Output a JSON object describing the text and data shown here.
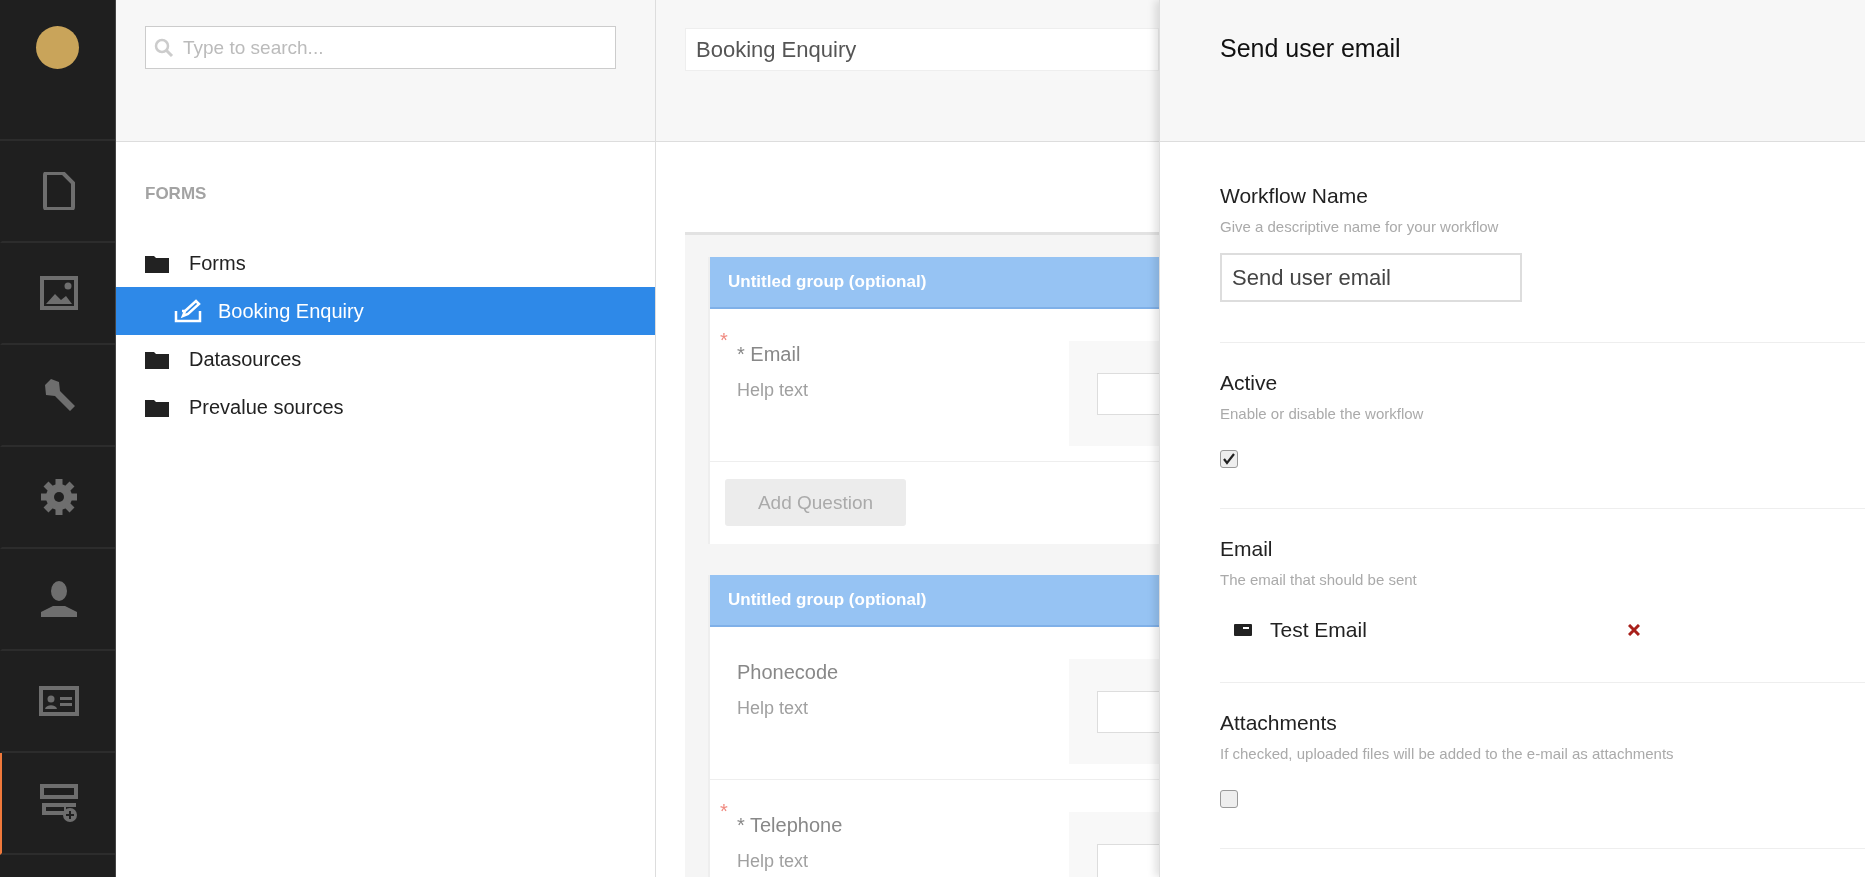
{
  "nav": {
    "sections": [
      {
        "kind": "document",
        "selected": false
      },
      {
        "kind": "image",
        "selected": false
      },
      {
        "kind": "wrench",
        "selected": false
      },
      {
        "kind": "gear",
        "selected": false
      },
      {
        "kind": "user",
        "selected": false
      },
      {
        "kind": "card",
        "selected": false
      },
      {
        "kind": "forms",
        "selected": true
      }
    ]
  },
  "tree": {
    "search": {
      "placeholder": "Type to search..."
    },
    "heading": "FORMS",
    "items": [
      {
        "label": "Forms",
        "kind": "folder",
        "selected": false,
        "children": [
          {
            "label": "Booking Enquiry",
            "kind": "form",
            "selected": true
          }
        ]
      },
      {
        "label": "Datasources",
        "kind": "folder",
        "selected": false
      },
      {
        "label": "Prevalue sources",
        "kind": "folder",
        "selected": false
      }
    ]
  },
  "editor": {
    "name": "Booking Enquiry",
    "groups": [
      {
        "title": "Untitled group (optional)",
        "questions": [
          {
            "required_mark": "*",
            "label": "* Email",
            "help": "Help text"
          }
        ],
        "add_button": "Add Question"
      },
      {
        "title": "Untitled group (optional)",
        "questions": [
          {
            "label": "Phonecode",
            "help": "Help text"
          },
          {
            "required_mark": "*",
            "label": "* Telephone",
            "help": "Help text"
          }
        ]
      }
    ]
  },
  "panel": {
    "title": "Send user email",
    "fields": [
      {
        "kind": "text",
        "label": "Workflow Name",
        "help": "Give a descriptive name for your workflow",
        "value": "Send user email"
      },
      {
        "kind": "checkbox",
        "label": "Active",
        "help": "Enable or disable the workflow",
        "checked": true
      },
      {
        "kind": "picker",
        "label": "Email",
        "help": "The email that should be sent",
        "items": [
          {
            "label": "Test Email"
          }
        ]
      },
      {
        "kind": "checkbox",
        "label": "Attachments",
        "help": "If checked, uploaded files will be added to the e-mail as attachments",
        "checked": false
      }
    ]
  }
}
